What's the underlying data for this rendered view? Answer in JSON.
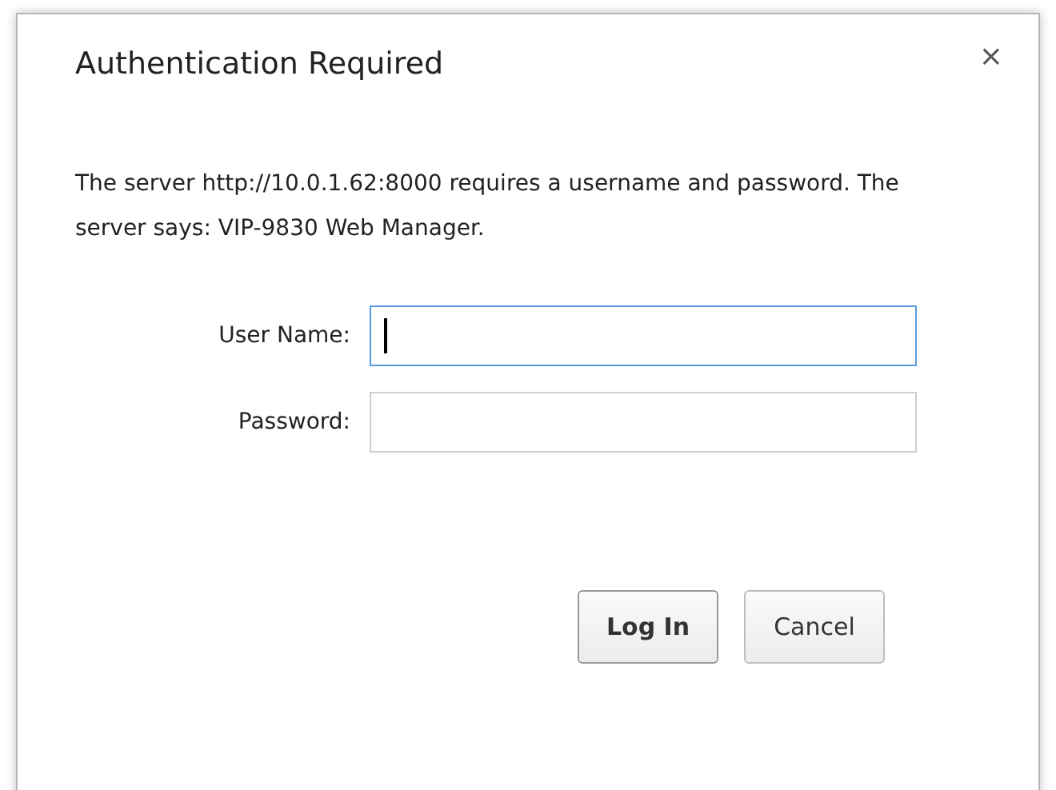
{
  "dialog": {
    "title": "Authentication Required",
    "close": "×",
    "message": "The server http://10.0.1.62:8000 requires a username and password. The server says: VIP-9830 Web Manager.",
    "fields": [
      {
        "label": "User Name:",
        "focused": true
      },
      {
        "label": "Password:",
        "focused": false
      }
    ],
    "buttons": [
      {
        "label": "Log In",
        "kind": "primary"
      },
      {
        "label": "Cancel",
        "kind": "secondary"
      }
    ]
  }
}
